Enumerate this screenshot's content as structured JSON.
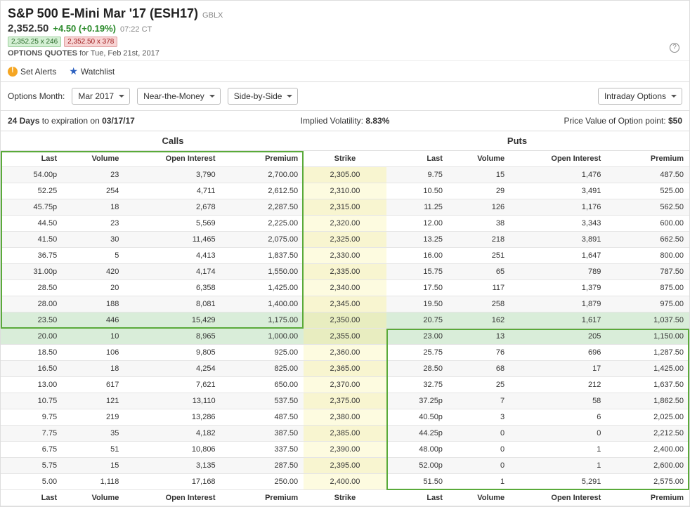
{
  "header": {
    "title": "S&P 500 E-Mini Mar '17 (ESH17)",
    "exchange": "GBLX",
    "price": "2,352.50",
    "change": "+4.50 (+0.19%)",
    "time": "07:22 CT",
    "badge_green": "2,352.25 x 246",
    "badge_red": "2,352.50 x 378",
    "quotes_label": "OPTIONS QUOTES",
    "quotes_for": " for Tue, Feb 21st, 2017"
  },
  "actions": {
    "alerts": "Set Alerts",
    "watchlist": "Watchlist"
  },
  "controls": {
    "month_label": "Options Month:",
    "month_value": "Mar 2017",
    "moneyness": "Near-the-Money",
    "view": "Side-by-Side",
    "intraday": "Intraday Options"
  },
  "info": {
    "days_prefix": "24 Days",
    "days_rest": " to expiration on ",
    "exp_date": "03/17/17",
    "iv_label": "Implied Volatility: ",
    "iv_value": "8.83%",
    "pv_label": "Price Value of Option point: ",
    "pv_value": "$50"
  },
  "sections": {
    "calls": "Calls",
    "puts": "Puts"
  },
  "columns": {
    "last": "Last",
    "volume": "Volume",
    "oi": "Open Interest",
    "premium": "Premium",
    "strike": "Strike"
  },
  "rows": [
    {
      "c_last": "54.00p",
      "c_vol": "23",
      "c_oi": "3,790",
      "c_prem": "2,700.00",
      "strike": "2,305.00",
      "p_last": "9.75",
      "p_vol": "15",
      "p_oi": "1,476",
      "p_prem": "487.50"
    },
    {
      "c_last": "52.25",
      "c_vol": "254",
      "c_oi": "4,711",
      "c_prem": "2,612.50",
      "strike": "2,310.00",
      "p_last": "10.50",
      "p_vol": "29",
      "p_oi": "3,491",
      "p_prem": "525.00"
    },
    {
      "c_last": "45.75p",
      "c_vol": "18",
      "c_oi": "2,678",
      "c_prem": "2,287.50",
      "strike": "2,315.00",
      "p_last": "11.25",
      "p_vol": "126",
      "p_oi": "1,176",
      "p_prem": "562.50"
    },
    {
      "c_last": "44.50",
      "c_vol": "23",
      "c_oi": "5,569",
      "c_prem": "2,225.00",
      "strike": "2,320.00",
      "p_last": "12.00",
      "p_vol": "38",
      "p_oi": "3,343",
      "p_prem": "600.00"
    },
    {
      "c_last": "41.50",
      "c_vol": "30",
      "c_oi": "11,465",
      "c_prem": "2,075.00",
      "strike": "2,325.00",
      "p_last": "13.25",
      "p_vol": "218",
      "p_oi": "3,891",
      "p_prem": "662.50"
    },
    {
      "c_last": "36.75",
      "c_vol": "5",
      "c_oi": "4,413",
      "c_prem": "1,837.50",
      "strike": "2,330.00",
      "p_last": "16.00",
      "p_vol": "251",
      "p_oi": "1,647",
      "p_prem": "800.00"
    },
    {
      "c_last": "31.00p",
      "c_vol": "420",
      "c_oi": "4,174",
      "c_prem": "1,550.00",
      "strike": "2,335.00",
      "p_last": "15.75",
      "p_vol": "65",
      "p_oi": "789",
      "p_prem": "787.50"
    },
    {
      "c_last": "28.50",
      "c_vol": "20",
      "c_oi": "6,358",
      "c_prem": "1,425.00",
      "strike": "2,340.00",
      "p_last": "17.50",
      "p_vol": "117",
      "p_oi": "1,379",
      "p_prem": "875.00"
    },
    {
      "c_last": "28.00",
      "c_vol": "188",
      "c_oi": "8,081",
      "c_prem": "1,400.00",
      "strike": "2,345.00",
      "p_last": "19.50",
      "p_vol": "258",
      "p_oi": "1,879",
      "p_prem": "975.00"
    },
    {
      "c_last": "23.50",
      "c_vol": "446",
      "c_oi": "15,429",
      "c_prem": "1,175.00",
      "strike": "2,350.00",
      "p_last": "20.75",
      "p_vol": "162",
      "p_oi": "1,617",
      "p_prem": "1,037.50",
      "hl": "green"
    },
    {
      "c_last": "20.00",
      "c_vol": "10",
      "c_oi": "8,965",
      "c_prem": "1,000.00",
      "strike": "2,355.00",
      "p_last": "23.00",
      "p_vol": "13",
      "p_oi": "205",
      "p_prem": "1,150.00",
      "hl": "green"
    },
    {
      "c_last": "18.50",
      "c_vol": "106",
      "c_oi": "9,805",
      "c_prem": "925.00",
      "strike": "2,360.00",
      "p_last": "25.75",
      "p_vol": "76",
      "p_oi": "696",
      "p_prem": "1,287.50"
    },
    {
      "c_last": "16.50",
      "c_vol": "18",
      "c_oi": "4,254",
      "c_prem": "825.00",
      "strike": "2,365.00",
      "p_last": "28.50",
      "p_vol": "68",
      "p_oi": "17",
      "p_prem": "1,425.00"
    },
    {
      "c_last": "13.00",
      "c_vol": "617",
      "c_oi": "7,621",
      "c_prem": "650.00",
      "strike": "2,370.00",
      "p_last": "32.75",
      "p_vol": "25",
      "p_oi": "212",
      "p_prem": "1,637.50"
    },
    {
      "c_last": "10.75",
      "c_vol": "121",
      "c_oi": "13,110",
      "c_prem": "537.50",
      "strike": "2,375.00",
      "p_last": "37.25p",
      "p_vol": "7",
      "p_oi": "58",
      "p_prem": "1,862.50"
    },
    {
      "c_last": "9.75",
      "c_vol": "219",
      "c_oi": "13,286",
      "c_prem": "487.50",
      "strike": "2,380.00",
      "p_last": "40.50p",
      "p_vol": "3",
      "p_oi": "6",
      "p_prem": "2,025.00"
    },
    {
      "c_last": "7.75",
      "c_vol": "35",
      "c_oi": "4,182",
      "c_prem": "387.50",
      "strike": "2,385.00",
      "p_last": "44.25p",
      "p_vol": "0",
      "p_oi": "0",
      "p_prem": "2,212.50"
    },
    {
      "c_last": "6.75",
      "c_vol": "51",
      "c_oi": "10,806",
      "c_prem": "337.50",
      "strike": "2,390.00",
      "p_last": "48.00p",
      "p_vol": "0",
      "p_oi": "1",
      "p_prem": "2,400.00"
    },
    {
      "c_last": "5.75",
      "c_vol": "15",
      "c_oi": "3,135",
      "c_prem": "287.50",
      "strike": "2,395.00",
      "p_last": "52.00p",
      "p_vol": "0",
      "p_oi": "1",
      "p_prem": "2,600.00"
    },
    {
      "c_last": "5.00",
      "c_vol": "1,118",
      "c_oi": "17,168",
      "c_prem": "250.00",
      "strike": "2,400.00",
      "p_last": "51.50",
      "p_vol": "1",
      "p_oi": "5,291",
      "p_prem": "2,575.00"
    }
  ]
}
